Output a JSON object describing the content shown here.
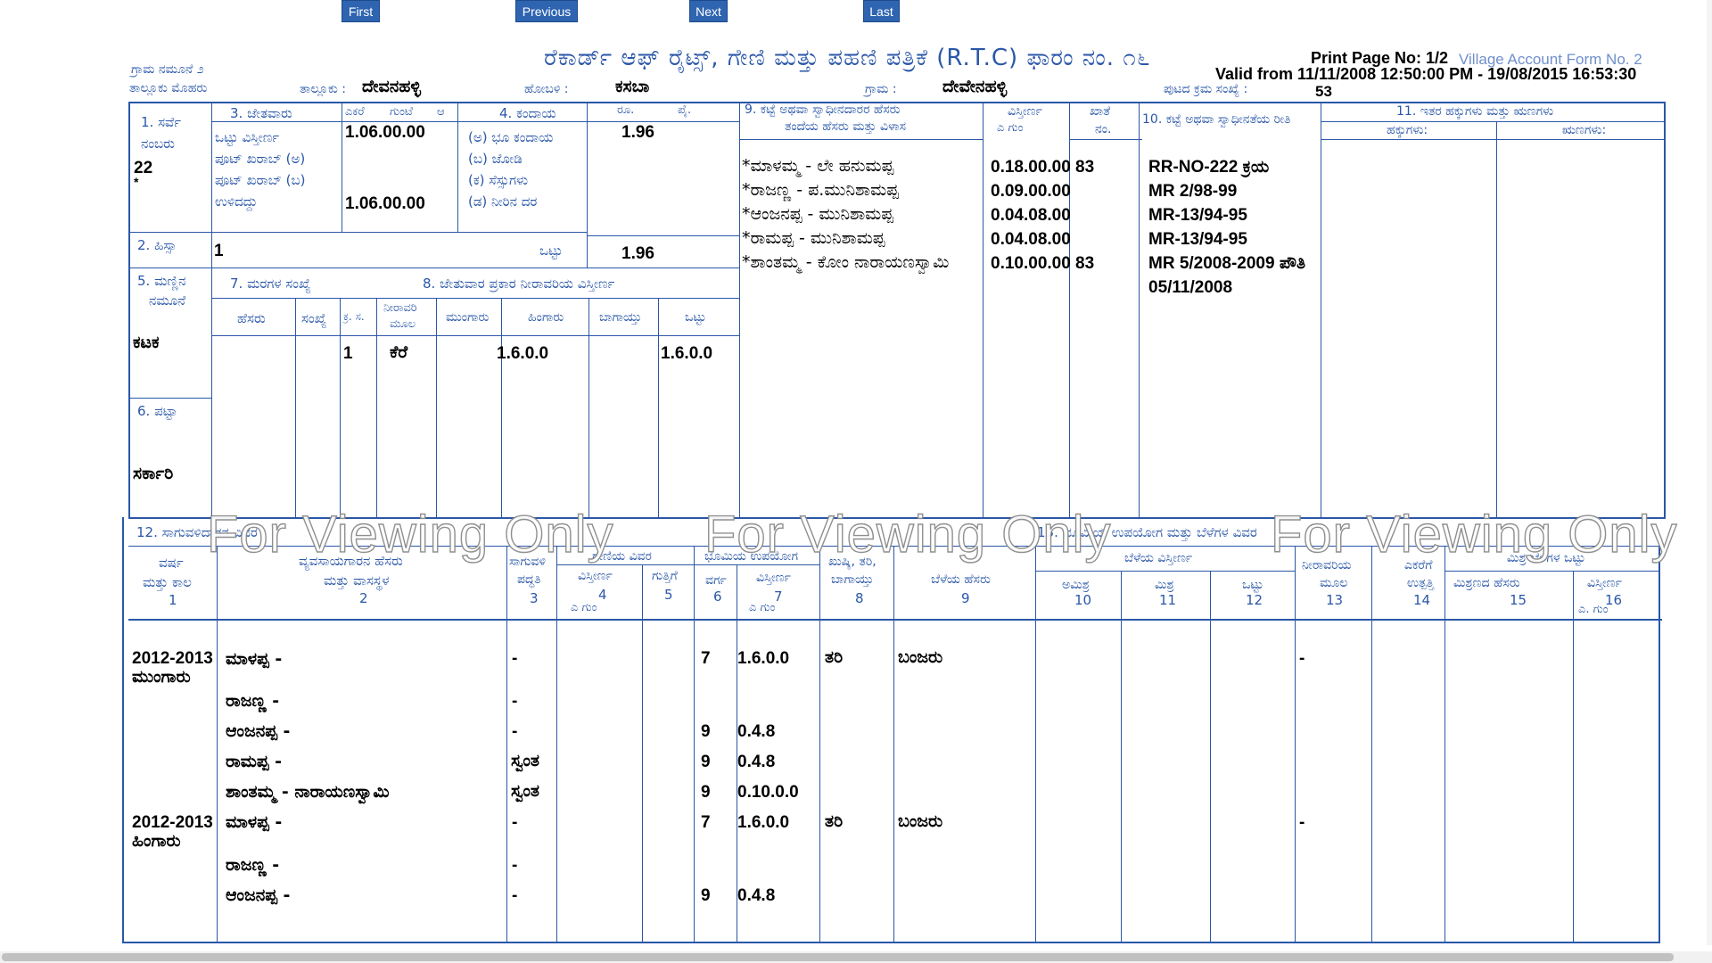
{
  "nav": {
    "first": "First",
    "previous": "Previous",
    "next": "Next",
    "last": "Last"
  },
  "header": {
    "form_no_kn": "ಗ್ರಾಮ ನಮೂನೆ ೨",
    "title": "ರೆಕಾರ್ಡ್ ಆಫ್ ರೈಟ್ಸ್, ಗೇಣಿ ಮತ್ತು ಪಹಣಿ ಪತ್ರಿಕೆ (R.T.C) ಫಾರಂ ನಂ. ೧೬",
    "print_page": "Print Page No: 1/2",
    "village_account_form": "Village Account Form No. 2",
    "valid_from": "Valid from 11/11/2008 12:50:00 PM - 19/08/2015 16:53:30",
    "taluk_seal_label": "ತಾಲ್ಲೂಕು ಮೊಹರು",
    "taluk_label": "ತಾಲ್ಲೂಕು :",
    "taluk_value": "ದೇವನಹಳ್ಳಿ",
    "hobli_label": "ಹೋಬಳಿ :",
    "hobli_value": "ಕಸಬಾ",
    "village_label": "ಗ್ರಾಮ :",
    "village_value": "ದೇವೇನಹಳ್ಳಿ",
    "page_no_label": "ಪುಟದ ಕ್ರಮ ಸಂಖ್ಯೆ :",
    "page_no_value": "53"
  },
  "top_table": {
    "h1_survey": "1. ಸರ್ವೆ",
    "h1_number": "ನಂಬರು",
    "survey_no": "22",
    "survey_star": "*",
    "h3_cultivator": "3. ಜೇತವಾರು",
    "h_acre": "ಎಕರೆ",
    "h_gunta": "ಗುಂಟೆ",
    "h_a": "ಆ",
    "total_extent_label": "ಒಟ್ಟು ವಿಸ್ತೀರ್ಣ",
    "pot_a_label": "ಪೂಟ್ ಖರಾಬ್ (ಅ)",
    "pot_b_label": "ಪೂಟ್ ಖರಾಬ್ (ಬ)",
    "remaining_label": "ಉಳಿದದ್ದು",
    "total_extent_value": "1.06.00.00",
    "remaining_value": "1.06.00.00",
    "h4_kandaya": "4. ಕಂದಾಯ",
    "kandaya_a": "(ಅ) ಭೂ ಕಂದಾಯ",
    "kandaya_b": "(ಬ) ಜೋಡಿ",
    "kandaya_c": "(ಕ) ಸೆಸ್ಸುಗಳು",
    "kandaya_d": "(ಡ) ನೀರಿನ ದರ",
    "h_rupees": "ರೂ.",
    "h_paise": "ಪೈ.",
    "kandaya_value": "1.96",
    "total_label": "ಒಟ್ಟು",
    "total_value": "1.96",
    "h2_hissa": "2. ಹಿಸ್ಸಾ",
    "hissa_value": "1",
    "h5_soil": "5. ಮಣ್ಣಿನ",
    "h5_type": "ನಮೂನೆ",
    "soil_value": "ಕಟಕ",
    "h6_patta": "6. ಪಟ್ಟಾ",
    "patta_value": "ಸರ್ಕಾರಿ",
    "h7_trees": "7. ಮರಗಳ ಸಂಖ್ಯೆ",
    "h7_name": "ಹೆಸರು",
    "h7_count": "ಸಂಖ್ಯೆ",
    "h8_irrigated": "8. ಜೇತುವಾರ ಪ್ರಕಾರ ನೀರಾವರಿಯ ವಿಸ್ತೀರ್ಣ",
    "h8_sno": "ಕ್ರ. ಸ.",
    "h8_source1": "ನೀರಾವರಿ",
    "h8_source2": "ಮೂಲ",
    "h8_mungaru": "ಮುಂಗಾರು",
    "h8_hingaru": "ಹಿಂಗಾರು",
    "h8_bagayat": "ಬಾಗಾಯ್ತು",
    "h8_total": "ಒಟ್ಟು",
    "irr_sno": "1",
    "irr_source": "ಕೆರೆ",
    "irr_hingaru": "1.6.0.0",
    "irr_total": "1.6.0.0",
    "h9_owner1": "9. ಕಟ್ಟೆ ಅಥವಾ ಸ್ವಾಧೀನದಾರರ ಹೆಸರು",
    "h9_owner2": "ತಂದೆಯ ಹೆಸರು ಮತ್ತು ವಿಳಾಸ",
    "h_extent": "ವಿಸ್ತೀರ್ಣ",
    "h_extent_units": "ಎ ಗುಂ",
    "h_khata1": "ಖಾತೆ",
    "h_khata2": "ನಂ.",
    "h10_mode": "10. ಕಟ್ಟೆ ಅಥವಾ ಸ್ವಾಧೀನತೆಯ ರೀತಿ",
    "h11_rights": "11. ಇತರ ಹಕ್ಕುಗಳು ಮತ್ತು ಋಣಗಳು",
    "h11_rights_sub": "ಹಕ್ಕುಗಳು:",
    "h11_liab_sub": "ಋಣಗಳು:",
    "owners": [
      {
        "name": "*ಮಾಳಮ್ಮ - ಲೇ ಹನುಮಪ್ಪ",
        "extent": "0.18.00.00",
        "khata": "83",
        "mode": "RR-NO-222 ಕ್ರಯ"
      },
      {
        "name": "*ರಾಜಣ್ಣ - ಪ.ಮುನಿಶಾಮಪ್ಪ",
        "extent": "0.09.00.00",
        "khata": "",
        "mode": "MR 2/98-99"
      },
      {
        "name": "*ಆಂಜನಪ್ಪ - ಮುನಿಶಾಮಪ್ಪ",
        "extent": "0.04.08.00",
        "khata": "",
        "mode": "MR-13/94-95"
      },
      {
        "name": "*ರಾಮಪ್ಪ - ಮುನಿಶಾಮಪ್ಪ",
        "extent": "0.04.08.00",
        "khata": "",
        "mode": "MR-13/94-95"
      },
      {
        "name": "*ಶಾಂತಮ್ಮ - ಕೋಂ ನಾರಾಯಣಸ್ವಾಮಿ",
        "extent": "0.10.00.00",
        "khata": "83",
        "mode": "MR 5/2008-2009 ಪೌತಿ"
      }
    ],
    "mode_extra": "05/11/2008"
  },
  "bottom_table": {
    "h12": "12. ಸಾಗುವಳಿದಾರನ ವಿವರ",
    "h13": "13. ಭೂಮಿಯ ಉಪಯೋಗ ಮತ್ತು ಬೆಳೆಗಳ ವಿವರ",
    "c1a": "ವರ್ಷ",
    "c1b": "ಮತ್ತು ಕಾಲ",
    "c1n": "1",
    "c2a": "ವ್ಯವಸಾಯಗಾರನ ಹೆಸರು",
    "c2b": "ಮತ್ತು ವಾಸಸ್ಥಳ",
    "c2n": "2",
    "c3a": "ಸಾಗುವಳಿ",
    "c3b": "ಪದ್ಧತಿ",
    "c3n": "3",
    "rent_group": "ಗೇಣಿಯ ವಿವರ",
    "c4a": "ವಿಸ್ತೀರ್ಣ",
    "c4n": "4",
    "c4u": "ಎ ಗುಂ",
    "c5a": "ಗುತ್ತಿಗೆ",
    "c5n": "5",
    "use_group": "ಭೂಮಿಯ ಉಪಯೋಗ",
    "c6a": "ವರ್ಗ",
    "c6n": "6",
    "c7a": "ವಿಸ್ತೀರ್ಣ",
    "c7n": "7",
    "c7u": "ಎ ಗುಂ",
    "c8a": "ಖುಷ್ಕಿ, ತರಿ,",
    "c8b": "ಬಾಗಾಯ್ತು",
    "c8n": "8",
    "c9a": "ಬೆಳೆಯ ಹೆಸರು",
    "c9n": "9",
    "crop_group": "ಬೆಳೆಯ ವಿಸ್ತೀರ್ಣ",
    "c10a": "ಅಮಿಶ್ರ",
    "c10n": "10",
    "c11a": "ಮಿಶ್ರ",
    "c11n": "11",
    "c12a": "ಒಟ್ಟು",
    "c12n": "12",
    "c13a": "ನೀರಾವರಿಯ",
    "c13b": "ಮೂಲ",
    "c13n": "13",
    "c14a": "ಎಕರೆಗೆ",
    "c14b": "ಉತ್ಪತ್ತಿ",
    "c14n": "14",
    "mixed_group": "ಮಿಶ್ರ ಬೆಳೆಗಳ ಒಟ್ಟು",
    "c15a": "ಮಿಶ್ರಣದ ಹೆಸರು",
    "c15n": "15",
    "c16a": "ವಿಸ್ತೀರ್ಣ",
    "c16n": "16",
    "c16u": "ಎ. ಗುಂ",
    "rows": [
      {
        "year": "2012-2013",
        "season": "ಮುಂಗಾರು",
        "name": "ಮಾಳಪ್ಪ -",
        "method": "-",
        "class": "7",
        "extent": "1.6.0.0",
        "type": "ತರಿ",
        "crop": "ಬಂಜರು",
        "irr": "-"
      },
      {
        "year": "",
        "season": "",
        "name": "ರಾಜಣ್ಣ -",
        "method": "-",
        "class": "",
        "extent": "",
        "type": "",
        "crop": "",
        "irr": ""
      },
      {
        "year": "",
        "season": "",
        "name": "ಆಂಜನಪ್ಪ -",
        "method": "-",
        "class": "9",
        "extent": "0.4.8",
        "type": "",
        "crop": "",
        "irr": ""
      },
      {
        "year": "",
        "season": "",
        "name": "ರಾಮಪ್ಪ -",
        "method": "ಸ್ವಂತ",
        "class": "9",
        "extent": "0.4.8",
        "type": "",
        "crop": "",
        "irr": ""
      },
      {
        "year": "",
        "season": "",
        "name": "ಶಾಂತಮ್ಮ - ನಾರಾಯಣಸ್ವಾಮಿ",
        "method": "ಸ್ವಂತ",
        "class": "9",
        "extent": "0.10.0.0",
        "type": "",
        "crop": "",
        "irr": ""
      },
      {
        "year": "2012-2013",
        "season": "ಹಿಂಗಾರು",
        "name": "ಮಾಳಪ್ಪ -",
        "method": "-",
        "class": "7",
        "extent": "1.6.0.0",
        "type": "ತರಿ",
        "crop": "ಬಂಜರು",
        "irr": "-"
      },
      {
        "year": "",
        "season": "",
        "name": "ರಾಜಣ್ಣ -",
        "method": "-",
        "class": "",
        "extent": "",
        "type": "",
        "crop": "",
        "irr": ""
      },
      {
        "year": "",
        "season": "",
        "name": "ಆಂಜನಪ್ಪ -",
        "method": "-",
        "class": "9",
        "extent": "0.4.8",
        "type": "",
        "crop": "",
        "irr": ""
      }
    ]
  },
  "watermark": [
    "For Viewing Only",
    "For Viewing Only",
    "For Viewing Only"
  ]
}
